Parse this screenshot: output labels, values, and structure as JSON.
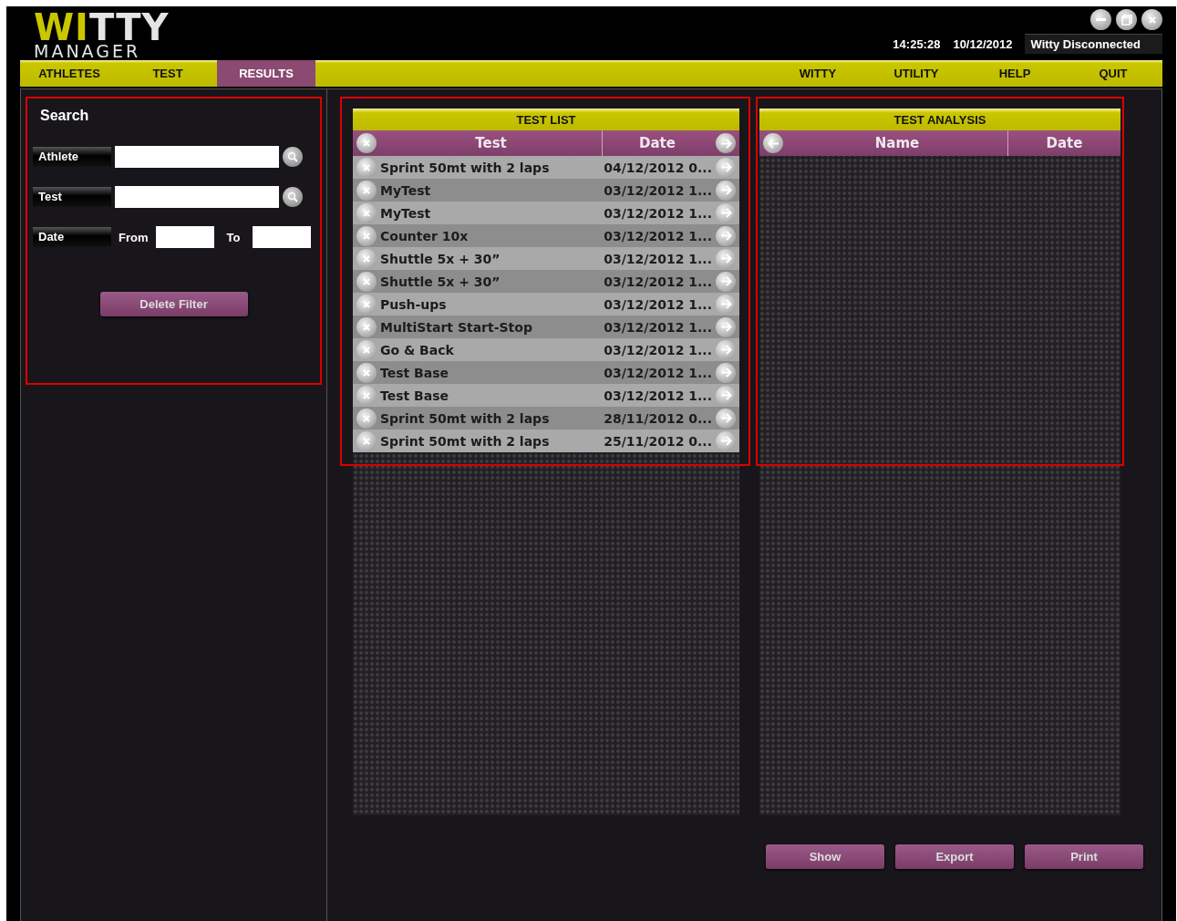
{
  "logo": {
    "parts": [
      {
        "text": "WI",
        "color": "#c9c600"
      },
      {
        "text": "TTY",
        "color": "#e4e4e4"
      }
    ],
    "subtitle": "MANAGER"
  },
  "window_controls": [
    {
      "kind": "minimize"
    },
    {
      "kind": "restore"
    },
    {
      "kind": "close"
    }
  ],
  "status": {
    "time": "14:25:28",
    "date": "10/12/2012",
    "connection": "Witty Disconnected"
  },
  "nav_left": [
    {
      "label": "ATHLETES",
      "selected": false
    },
    {
      "label": "TEST",
      "selected": false
    },
    {
      "label": "RESULTS",
      "selected": true
    }
  ],
  "nav_right": [
    {
      "label": "WITTY"
    },
    {
      "label": "UTILITY"
    },
    {
      "label": "HELP"
    },
    {
      "label": "QUIT"
    }
  ],
  "search": {
    "title": "Search",
    "athlete_label": "Athlete",
    "test_label": "Test",
    "date_label": "Date",
    "from_label": "From",
    "to_label": "To",
    "delete_button": "Delete Filter"
  },
  "test_list": {
    "title": "TEST LIST",
    "columns": [
      "Test",
      "Date"
    ],
    "rows": [
      {
        "test": "Sprint 50mt with 2 laps",
        "date": "04/12/2012  0..."
      },
      {
        "test": "MyTest",
        "date": "03/12/2012  1..."
      },
      {
        "test": "MyTest",
        "date": "03/12/2012  1..."
      },
      {
        "test": "Counter 10x",
        "date": "03/12/2012  1..."
      },
      {
        "test": "Shuttle 5x + 30”",
        "date": "03/12/2012  1..."
      },
      {
        "test": "Shuttle 5x + 30”",
        "date": "03/12/2012  1..."
      },
      {
        "test": "Push-ups",
        "date": "03/12/2012  1..."
      },
      {
        "test": "MultiStart Start-Stop",
        "date": "03/12/2012  1..."
      },
      {
        "test": "Go & Back",
        "date": "03/12/2012  1..."
      },
      {
        "test": "Test Base",
        "date": "03/12/2012  1..."
      },
      {
        "test": "Test Base",
        "date": "03/12/2012  1..."
      },
      {
        "test": "Sprint 50mt with 2 laps",
        "date": "28/11/2012  0..."
      },
      {
        "test": "Sprint 50mt with 2 laps",
        "date": "25/11/2012  0..."
      }
    ]
  },
  "test_analysis": {
    "title": "TEST ANALYSIS",
    "columns": [
      "Name",
      "Date"
    ]
  },
  "actions": [
    "Show",
    "Export",
    "Print"
  ]
}
